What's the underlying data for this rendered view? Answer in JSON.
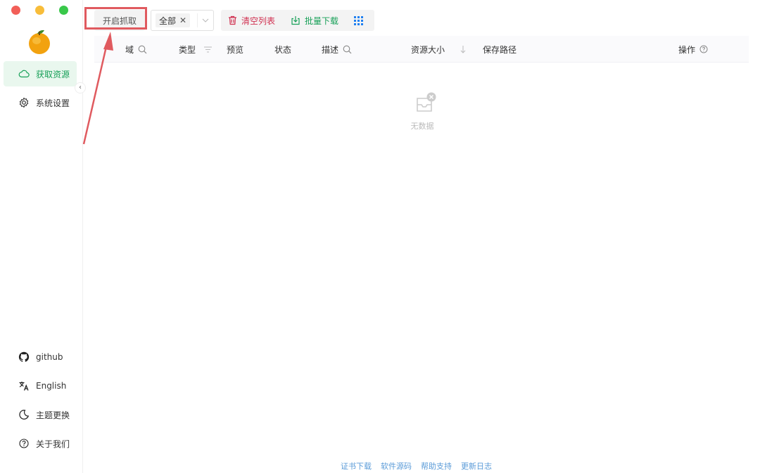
{
  "window_controls": {
    "close": "close",
    "minimize": "minimize",
    "maximize": "maximize"
  },
  "sidebar": {
    "items": [
      {
        "label": "获取资源",
        "icon": "cloud-icon",
        "active": true
      },
      {
        "label": "系统设置",
        "icon": "gear-icon",
        "active": false
      }
    ],
    "collapse_glyph": "‹",
    "bottom_items": [
      {
        "label": "github",
        "icon": "github-icon"
      },
      {
        "label": "English",
        "icon": "translate-icon"
      },
      {
        "label": "主题更换",
        "icon": "moon-icon"
      },
      {
        "label": "关于我们",
        "icon": "help-circle-icon"
      }
    ]
  },
  "toolbar": {
    "capture_label": "开启抓取",
    "filter_tag": "全部",
    "clear_label": "清空列表",
    "download_label": "批量下载"
  },
  "table": {
    "columns": [
      {
        "label": "域",
        "icon": "search-icon"
      },
      {
        "label": "类型",
        "icon": "filter-icon"
      },
      {
        "label": "预览"
      },
      {
        "label": "状态"
      },
      {
        "label": "描述",
        "icon": "search-icon"
      },
      {
        "label": "资源大小",
        "icon": "sort-down-icon"
      },
      {
        "label": "保存路径"
      },
      {
        "label": "操作",
        "icon": "help-circle-icon"
      }
    ],
    "empty_text": "无数据"
  },
  "footer": {
    "links": [
      "证书下载",
      "软件源码",
      "帮助支持",
      "更新日志"
    ]
  },
  "colors": {
    "accent": "#18a058",
    "danger": "#d03050",
    "link": "#5a9bd8",
    "highlight": "#e05a5f"
  }
}
